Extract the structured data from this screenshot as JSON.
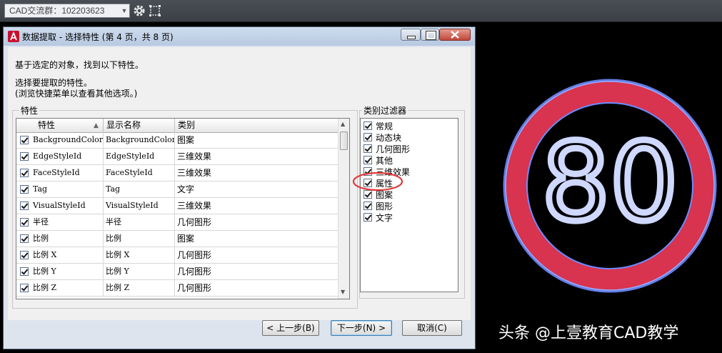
{
  "toolbar": {
    "combo_value": "CAD交流群：102203623",
    "icons": [
      "gear-icon",
      "select-frame-icon"
    ]
  },
  "dialog": {
    "title": "数据提取 - 选择特性 (第 4 页，共 8 页)",
    "intro": "基于选定的对象，找到以下特性。",
    "instruction1": "选择要提取的特性。",
    "instruction2": "(浏览快捷菜单以查看其他选项。)",
    "properties_group_label": "特性",
    "columns": [
      "特性",
      "显示名称",
      "类别"
    ],
    "rows": [
      {
        "prop": "BackgroundColor",
        "display": "BackgroundColor",
        "category": "图案",
        "checked": true
      },
      {
        "prop": "EdgeStyleId",
        "display": "EdgeStyleId",
        "category": "三维效果",
        "checked": true
      },
      {
        "prop": "FaceStyleId",
        "display": "FaceStyleId",
        "category": "三维效果",
        "checked": true
      },
      {
        "prop": "Tag",
        "display": "Tag",
        "category": "文字",
        "checked": true
      },
      {
        "prop": "VisualStyleId",
        "display": "VisualStyleId",
        "category": "三维效果",
        "checked": true
      },
      {
        "prop": "半径",
        "display": "半径",
        "category": "几何图形",
        "checked": true
      },
      {
        "prop": "比例",
        "display": "比例",
        "category": "图案",
        "checked": true
      },
      {
        "prop": "比例 X",
        "display": "比例 X",
        "category": "几何图形",
        "checked": true
      },
      {
        "prop": "比例 Y",
        "display": "比例 Y",
        "category": "几何图形",
        "checked": true
      },
      {
        "prop": "比例 Z",
        "display": "比例 Z",
        "category": "几何图形",
        "checked": true
      }
    ],
    "filter_group_label": "类别过滤器",
    "filters": [
      {
        "label": "常规",
        "checked": true
      },
      {
        "label": "动态块",
        "checked": true
      },
      {
        "label": "几何图形",
        "checked": true
      },
      {
        "label": "其他",
        "checked": true
      },
      {
        "label": "三维效果",
        "checked": true
      },
      {
        "label": "属性",
        "checked": true
      },
      {
        "label": "图案",
        "checked": true
      },
      {
        "label": "图形",
        "checked": true
      },
      {
        "label": "文字",
        "checked": true
      }
    ],
    "buttons": {
      "back": "< 上一步(B)",
      "next": "下一步(N) >",
      "cancel": "取消(C)"
    }
  },
  "sign": {
    "number": "80"
  },
  "watermark": "头条 @上壹教育CAD教学",
  "colors": {
    "highlight_circle": "#e23a3a",
    "sign_ring": "#d8334f",
    "sign_glow": "#6d8cff",
    "sign_digits": "#cfd8ff"
  }
}
